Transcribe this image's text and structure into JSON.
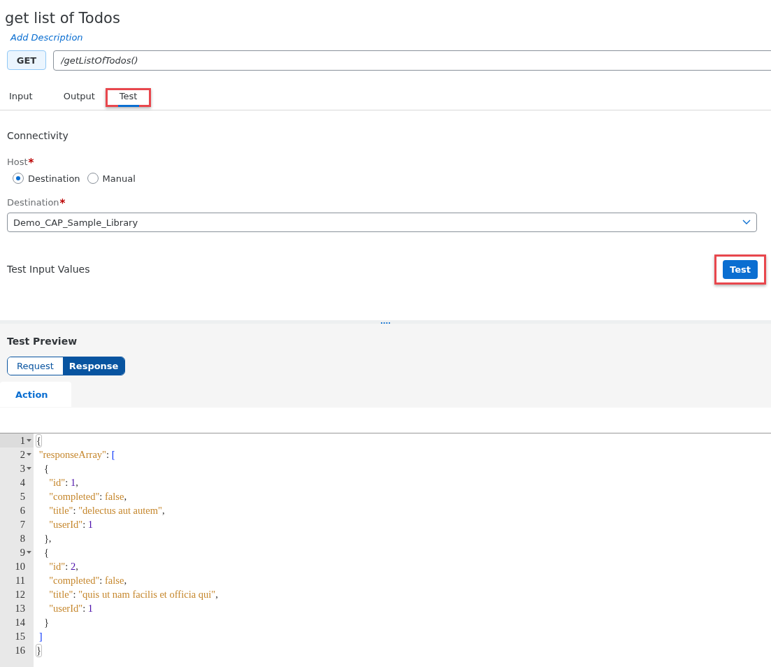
{
  "title": "get list of Todos",
  "description_link": "Add Description",
  "method": "GET",
  "path": {
    "value": "/getListOfTodos()"
  },
  "tabs": [
    {
      "label": "Input",
      "selected": false,
      "highlighted": false
    },
    {
      "label": "Output",
      "selected": false,
      "highlighted": false
    },
    {
      "label": "Test",
      "selected": true,
      "highlighted": true
    }
  ],
  "connectivity": {
    "heading": "Connectivity",
    "host": {
      "label": "Host",
      "required_mark": "*",
      "options": [
        {
          "label": "Destination",
          "selected": true
        },
        {
          "label": "Manual",
          "selected": false
        }
      ]
    },
    "destination": {
      "label": "Destination",
      "required_mark": "*",
      "value": "Demo_CAP_Sample_Library"
    }
  },
  "test_input": {
    "heading": "Test Input Values",
    "button": {
      "label": "Test",
      "highlighted": true
    }
  },
  "splitter_handle": "....",
  "preview": {
    "heading": "Test Preview",
    "segments": [
      {
        "label": "Request",
        "selected": false
      },
      {
        "label": "Response",
        "selected": true
      }
    ],
    "tabs": [
      {
        "label": "Action",
        "selected": true
      }
    ]
  },
  "editor": {
    "lines": [
      {
        "number": "1",
        "foldable": true,
        "active": true,
        "tokens": [
          {
            "kind": "match",
            "text": "{"
          }
        ]
      },
      {
        "number": "2",
        "foldable": true,
        "active": false,
        "tokens": [
          {
            "kind": "key",
            "text": " \"responseArray\""
          },
          {
            "kind": "punct",
            "text": ": "
          },
          {
            "kind": "bracket",
            "text": "["
          }
        ]
      },
      {
        "number": "3",
        "foldable": true,
        "active": false,
        "tokens": [
          {
            "kind": "punct",
            "text": "   {"
          }
        ]
      },
      {
        "number": "4",
        "foldable": false,
        "active": false,
        "tokens": [
          {
            "kind": "key",
            "text": "     \"id\""
          },
          {
            "kind": "punct",
            "text": ": "
          },
          {
            "kind": "number",
            "text": "1"
          },
          {
            "kind": "punct",
            "text": ","
          }
        ]
      },
      {
        "number": "5",
        "foldable": false,
        "active": false,
        "tokens": [
          {
            "kind": "key",
            "text": "     \"completed\""
          },
          {
            "kind": "punct",
            "text": ": "
          },
          {
            "kind": "bool",
            "text": "false"
          },
          {
            "kind": "punct",
            "text": ","
          }
        ]
      },
      {
        "number": "6",
        "foldable": false,
        "active": false,
        "tokens": [
          {
            "kind": "key",
            "text": "     \"title\""
          },
          {
            "kind": "punct",
            "text": ": "
          },
          {
            "kind": "string",
            "text": "\"delectus aut autem\""
          },
          {
            "kind": "punct",
            "text": ","
          }
        ]
      },
      {
        "number": "7",
        "foldable": false,
        "active": false,
        "tokens": [
          {
            "kind": "key",
            "text": "     \"userId\""
          },
          {
            "kind": "punct",
            "text": ": "
          },
          {
            "kind": "number",
            "text": "1"
          }
        ]
      },
      {
        "number": "8",
        "foldable": false,
        "active": false,
        "tokens": [
          {
            "kind": "punct",
            "text": "   },"
          }
        ]
      },
      {
        "number": "9",
        "foldable": true,
        "active": false,
        "tokens": [
          {
            "kind": "punct",
            "text": "   {"
          }
        ]
      },
      {
        "number": "10",
        "foldable": false,
        "active": false,
        "tokens": [
          {
            "kind": "key",
            "text": "     \"id\""
          },
          {
            "kind": "punct",
            "text": ": "
          },
          {
            "kind": "number",
            "text": "2"
          },
          {
            "kind": "punct",
            "text": ","
          }
        ]
      },
      {
        "number": "11",
        "foldable": false,
        "active": false,
        "tokens": [
          {
            "kind": "key",
            "text": "     \"completed\""
          },
          {
            "kind": "punct",
            "text": ": "
          },
          {
            "kind": "bool",
            "text": "false"
          },
          {
            "kind": "punct",
            "text": ","
          }
        ]
      },
      {
        "number": "12",
        "foldable": false,
        "active": false,
        "tokens": [
          {
            "kind": "key",
            "text": "     \"title\""
          },
          {
            "kind": "punct",
            "text": ": "
          },
          {
            "kind": "string",
            "text": "\"quis ut nam facilis et officia qui\""
          },
          {
            "kind": "punct",
            "text": ","
          }
        ]
      },
      {
        "number": "13",
        "foldable": false,
        "active": false,
        "tokens": [
          {
            "kind": "key",
            "text": "     \"userId\""
          },
          {
            "kind": "punct",
            "text": ": "
          },
          {
            "kind": "number",
            "text": "1"
          }
        ]
      },
      {
        "number": "14",
        "foldable": false,
        "active": false,
        "tokens": [
          {
            "kind": "punct",
            "text": "   }"
          }
        ]
      },
      {
        "number": "15",
        "foldable": false,
        "active": false,
        "tokens": [
          {
            "kind": "bracket",
            "text": " ]"
          }
        ]
      },
      {
        "number": "16",
        "foldable": false,
        "active": false,
        "tokens": [
          {
            "kind": "match",
            "text": "}"
          }
        ]
      }
    ]
  }
}
